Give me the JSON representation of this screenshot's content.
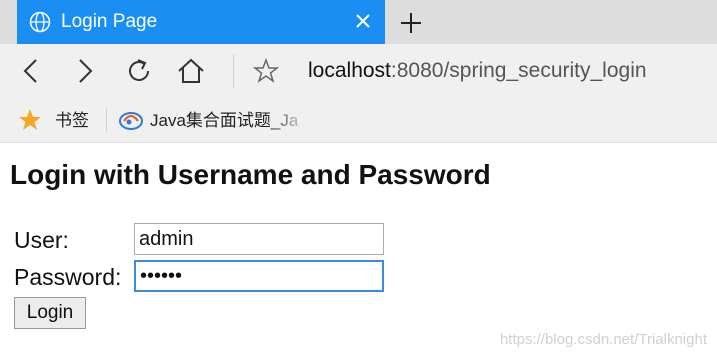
{
  "tab": {
    "title": "Login Page",
    "icon": "globe-icon"
  },
  "nav": {
    "url_host": "localhost",
    "url_rest": ":8080/spring_security_login"
  },
  "bookmarks": [
    {
      "label": "书签"
    },
    {
      "label": "Java集合面试题_Ja"
    }
  ],
  "page": {
    "heading": "Login with Username and Password",
    "user_label": "User:",
    "user_value": "admin",
    "password_label": "Password:",
    "password_value": "••••••",
    "submit_label": "Login"
  },
  "watermark": "https://blog.csdn.net/Trialknight",
  "colors": {
    "tab_active": "#1a8ef2",
    "focus_border": "#3b8cdd",
    "bookmark_star": "#f5a623"
  }
}
